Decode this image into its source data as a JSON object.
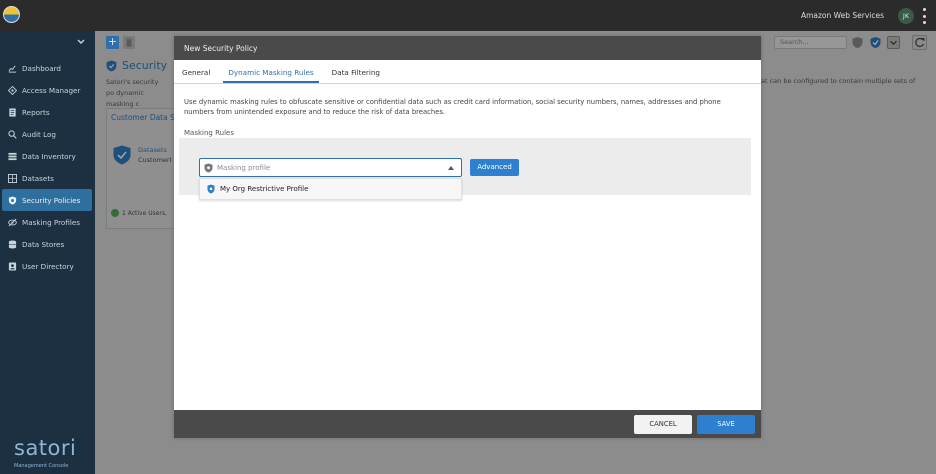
{
  "topbar": {
    "account": "Amazon Web Services",
    "user_initials": "JK"
  },
  "sidebar": {
    "items": [
      {
        "label": "Dashboard",
        "icon": "dashboard-icon"
      },
      {
        "label": "Access Manager",
        "icon": "access-icon"
      },
      {
        "label": "Reports",
        "icon": "reports-icon"
      },
      {
        "label": "Audit Log",
        "icon": "search-icon"
      },
      {
        "label": "Data Inventory",
        "icon": "inventory-icon"
      },
      {
        "label": "Datasets",
        "icon": "datasets-icon"
      },
      {
        "label": "Security Policies",
        "icon": "shield-icon",
        "active": true
      },
      {
        "label": "Masking Profiles",
        "icon": "eye-slash-icon"
      },
      {
        "label": "Data Stores",
        "icon": "database-icon"
      },
      {
        "label": "User Directory",
        "icon": "directory-icon"
      }
    ],
    "brand": "satori",
    "brand_sub": "Management Console"
  },
  "background": {
    "title": "Security",
    "desc_left": "Satori's security po dynamic masking c",
    "desc_right": "at can be configured to contain multiple sets of",
    "card_title": "Customer Data S",
    "card_datasets": "Datasets",
    "card_customer": "CustomerI",
    "card_active": "1 Active Users,",
    "search_placeholder": "Search..."
  },
  "modal": {
    "title": "New Security Policy",
    "tabs": [
      {
        "label": "General",
        "active": false
      },
      {
        "label": "Dynamic Masking Rules",
        "active": true
      },
      {
        "label": "Data Filtering",
        "active": false
      }
    ],
    "description": "Use dynamic masking rules to obfuscate sensitive or confidential data such as credit card information, social security numbers, names, addresses and phone numbers from unintended exposure and to reduce the risk of data breaches.",
    "rules_label": "Masking Rules",
    "profile_placeholder": "Masking profile",
    "dropdown_option": "My Org Restrictive Profile",
    "advanced_label": "Advanced",
    "cancel_label": "CANCEL",
    "save_label": "SAVE"
  },
  "colors": {
    "accent": "#2f7fd0",
    "sidebar_bg": "#1c3042",
    "active_nav": "#2f6f9e"
  }
}
